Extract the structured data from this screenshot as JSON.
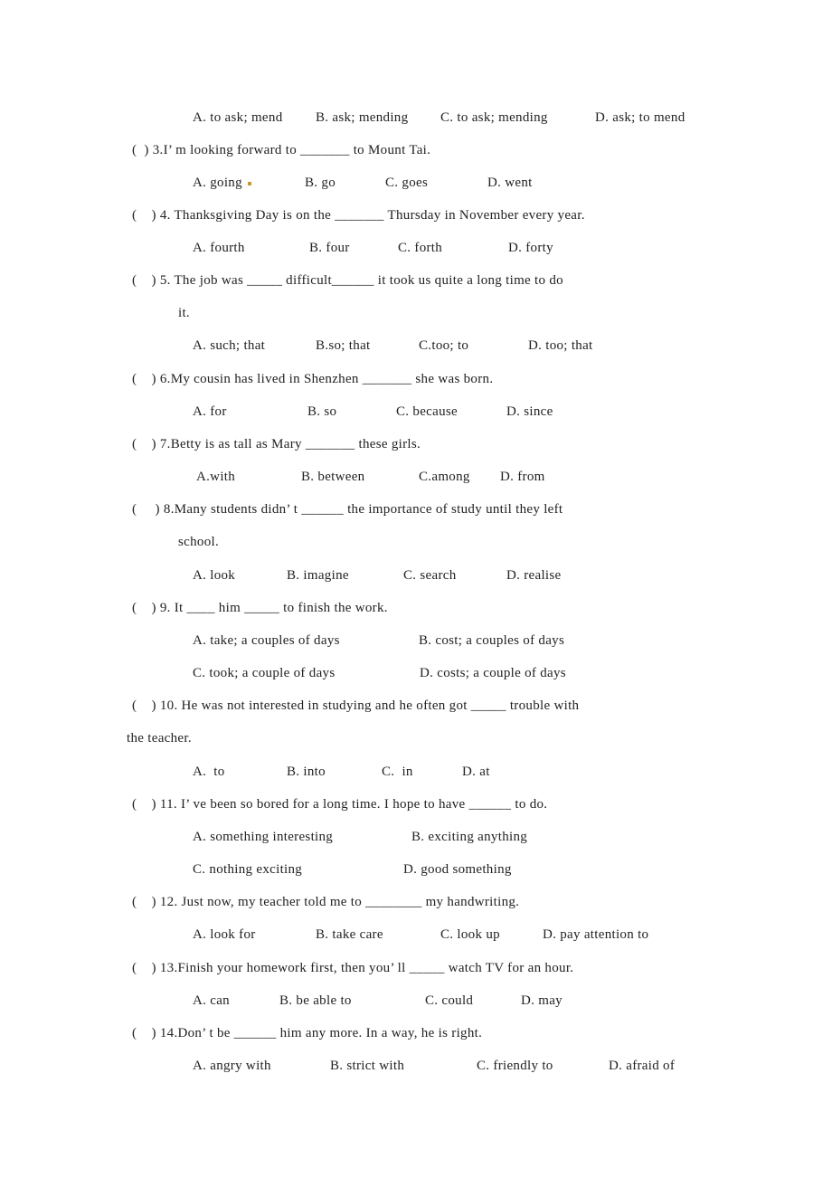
{
  "lines": [
    {
      "type": "options",
      "items": [
        "A. to ask; mend",
        "B. ask; mending",
        "C. to ask; mending",
        "D. ask; to mend"
      ]
    },
    {
      "type": "question",
      "text": "(  ) 3.I’ m looking forward to _______ to Mount Tai."
    },
    {
      "type": "options",
      "items": [
        "A. going",
        "B. go",
        "C. goes",
        "D. went"
      ]
    },
    {
      "type": "question",
      "text": "(    ) 4. Thanksgiving Day is on the _______ Thursday in November every year."
    },
    {
      "type": "options",
      "items": [
        "A. fourth",
        "B. four",
        "C. forth",
        "D. forty"
      ]
    },
    {
      "type": "question",
      "text": "(    ) 5. The job was _____ difficult______ it took us quite a long time to do"
    },
    {
      "type": "continuation",
      "text": "it."
    },
    {
      "type": "options",
      "items": [
        "A. such; that",
        "B.so; that",
        "C.too; to",
        "D. too; that"
      ]
    },
    {
      "type": "question",
      "text": "(    ) 6.My cousin has lived in Shenzhen _______ she was born."
    },
    {
      "type": "options",
      "items": [
        "A. for",
        "B. so",
        "C. because",
        "D. since"
      ]
    },
    {
      "type": "question",
      "text": "(    ) 7.Betty is as tall as Mary _______ these girls."
    },
    {
      "type": "options",
      "items": [
        "A.with",
        "B. between",
        "C.among",
        "D. from"
      ]
    },
    {
      "type": "question",
      "text": "(     ) 8.Many students didn’ t ______ the importance of study until they left"
    },
    {
      "type": "continuation",
      "text": "school."
    },
    {
      "type": "options",
      "items": [
        "A. look",
        "B. imagine",
        "C. search",
        "D. realise"
      ]
    },
    {
      "type": "question",
      "text": "(    ) 9. It ____ him _____ to finish the work."
    },
    {
      "type": "options",
      "items": [
        "A. take; a couples of days",
        "B. cost; a couples of days"
      ]
    },
    {
      "type": "options",
      "items": [
        "C. took; a couple of days",
        "D. costs; a couple of days"
      ]
    },
    {
      "type": "question",
      "text": "(    ) 10. He was not interested in studying and he often got _____ trouble with"
    },
    {
      "type": "continuation2",
      "text": "the teacher."
    },
    {
      "type": "options",
      "items": [
        "A.  to",
        "B. into",
        "C.  in",
        "D. at"
      ]
    },
    {
      "type": "question",
      "text": "(    ) 11. I’ ve been so bored for a long time. I hope to have ______ to do."
    },
    {
      "type": "options",
      "items": [
        "A. something interesting",
        "B. exciting anything"
      ]
    },
    {
      "type": "options",
      "items": [
        "C. nothing exciting",
        "D. good something"
      ]
    },
    {
      "type": "question",
      "text": "(    ) 12. Just now, my teacher told me to ________ my handwriting."
    },
    {
      "type": "options",
      "items": [
        "A. look for",
        "B. take care",
        "C. look up",
        "D. pay attention to"
      ]
    },
    {
      "type": "question",
      "text": "(    ) 13.Finish your homework first, then you’ ll _____ watch TV for an hour."
    },
    {
      "type": "options",
      "items": [
        "A. can",
        "B. be able to",
        "C. could",
        "D. may"
      ]
    },
    {
      "type": "question",
      "text": "(    ) 14.Don’ t be ______ him any more. In a way, he is right."
    },
    {
      "type": "options",
      "items": [
        "A. angry with",
        "B. strict with",
        "C. friendly to",
        "D. afraid of"
      ]
    }
  ],
  "marker_color": "#c89a2a"
}
